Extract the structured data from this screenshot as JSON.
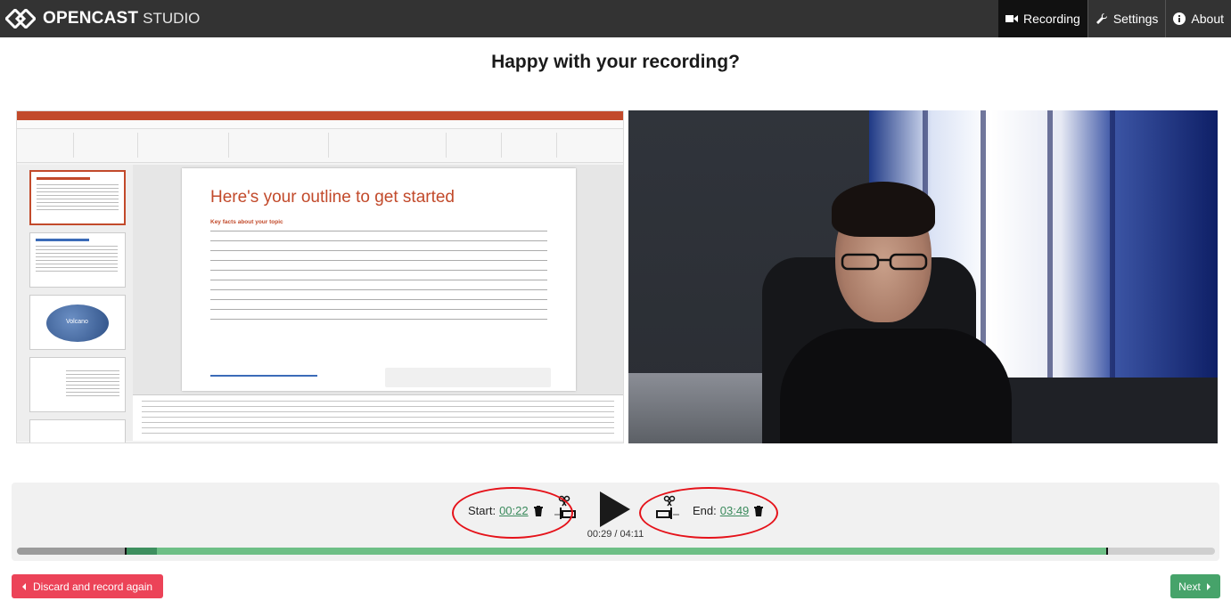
{
  "app": {
    "brand_bold": "OPENCAST",
    "brand_light": "STUDIO"
  },
  "nav": {
    "recording": "Recording",
    "settings": "Settings",
    "about": "About"
  },
  "page": {
    "title": "Happy with your recording?"
  },
  "slide": {
    "heading": "Here's your outline to get started",
    "subheading": "Key facts about your topic",
    "thumb_label": "Volcano"
  },
  "editor": {
    "start_label": "Start:",
    "start_time": "00:22",
    "end_label": "End:",
    "end_time": "03:49",
    "current_time": "00:29 / 04:11",
    "progress": {
      "played_until_fraction": 0.117,
      "start_fraction": 0.088,
      "end_fraction": 0.822
    }
  },
  "actions": {
    "discard": "Discard and record again",
    "next": "Next"
  },
  "colors": {
    "header_bg": "#333333",
    "discard_bg": "#ec4358",
    "next_bg": "#46a36a",
    "accent_green": "#3a8a5c",
    "annotation_red": "#e5121a"
  },
  "icons": {
    "logo": "opencast-logo",
    "recording": "video-camera-icon",
    "settings": "wrench-icon",
    "about": "info-circle-icon",
    "trash": "trash-icon",
    "cut": "scissors-icon",
    "play": "play-icon"
  }
}
